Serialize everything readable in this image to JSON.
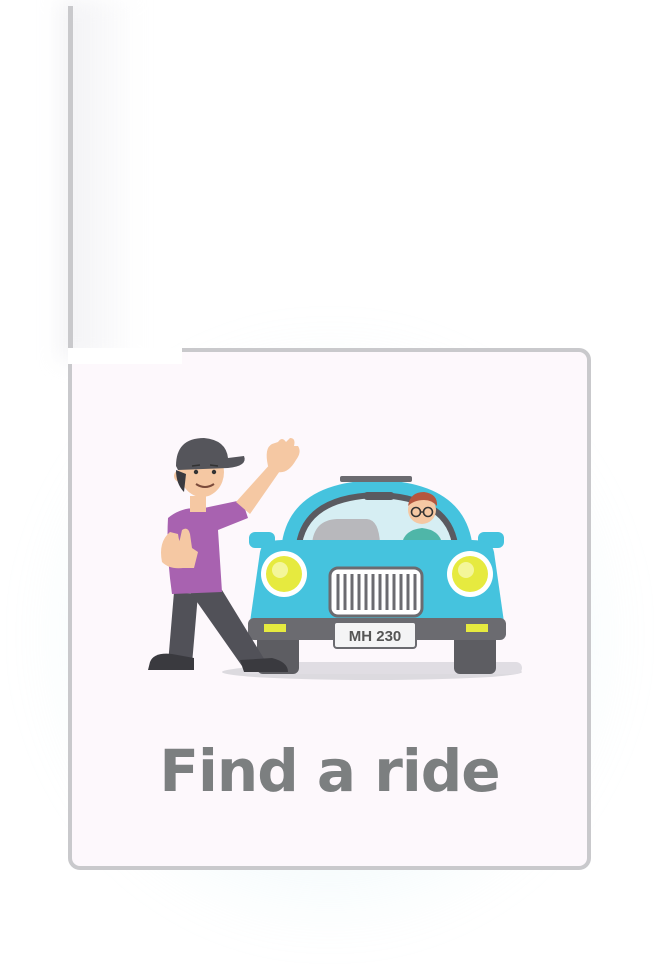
{
  "card": {
    "title": "Find a ride",
    "plate_text": "MH 230"
  },
  "colors": {
    "card_background": "#fdf8fc",
    "card_border": "#c9c9cc",
    "title_text": "#7c7f80",
    "car_body": "#45c3de",
    "shirt": "#a862b0"
  },
  "icons": {
    "illustration": "hitchhiker-with-car-illustration"
  }
}
